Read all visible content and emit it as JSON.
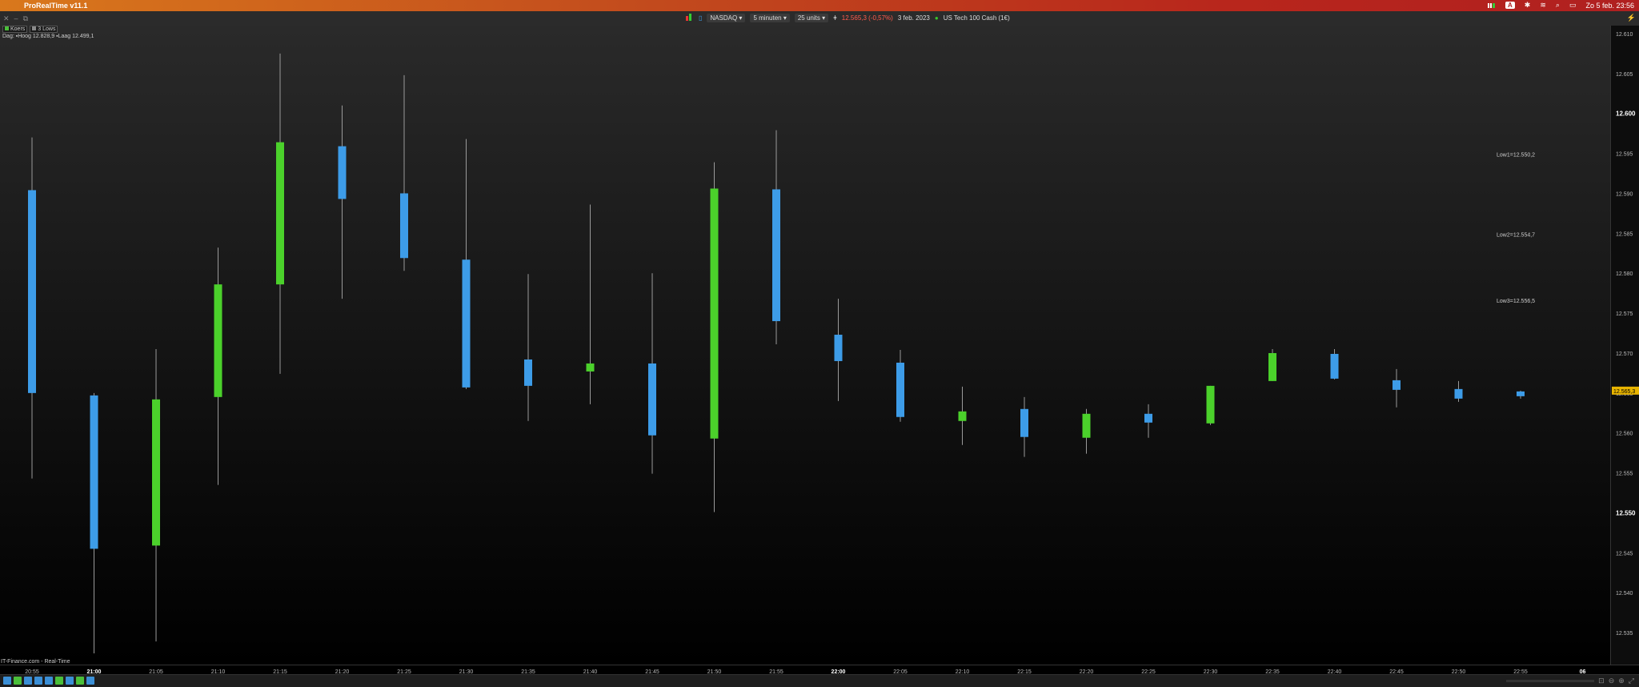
{
  "menubar": {
    "app_name": "ProRealTime v11.1",
    "datetime": "Zo 5 feb. 23:56",
    "input_badge": "A"
  },
  "toolbar": {
    "exchange": "NASDAQ",
    "timeframe": "5 minuten",
    "units": "25 units",
    "price_change": "12.565,3 (-0,57%)",
    "date": "3 feb. 2023",
    "instrument": "US Tech 100 Cash (1€)"
  },
  "legend": {
    "items": [
      "Koers",
      "3 Lows"
    ],
    "colors": [
      "#4bbf3a",
      "#8a8a8a"
    ]
  },
  "info": {
    "text": "Dag: ▪Hoog 12.828,9 ▪Laag 12.499,1"
  },
  "footer": {
    "source": "IT-Finance.com - Real-Time"
  },
  "colors": {
    "up": "#4bd12b",
    "down": "#3d9ce8",
    "wick": "#9a9a9a",
    "current_price_bg": "#e8b400"
  },
  "chart_data": {
    "type": "candlestick",
    "ylim": [
      12531,
      12611
    ],
    "y_ticks": [
      12610,
      12605,
      12600,
      12595,
      12590,
      12585,
      12580,
      12575,
      12570,
      12565,
      12560,
      12555,
      12550,
      12545,
      12540,
      12535
    ],
    "y_tick_labels": [
      "12.610",
      "12.605",
      "12.600",
      "12.595",
      "12.590",
      "12.585",
      "12.580",
      "12.575",
      "12.570",
      "12.565",
      "12.560",
      "12.555",
      "12.550",
      "12.545",
      "12.540",
      "12.535"
    ],
    "bold_ticks": [
      "12.600",
      "12.550"
    ],
    "current_price": 12565.3,
    "current_price_label": "12.565,3",
    "x_labels": [
      "20:55",
      "21:00",
      "21:05",
      "21:10",
      "21:15",
      "21:20",
      "21:25",
      "21:30",
      "21:35",
      "21:40",
      "21:45",
      "21:50",
      "21:55",
      "22:00",
      "22:05",
      "22:10",
      "22:15",
      "22:20",
      "22:25",
      "22:30",
      "22:35",
      "22:40",
      "22:45",
      "22:50",
      "22:55",
      "06"
    ],
    "bold_x_labels": [
      "21:00",
      "22:00",
      "06"
    ],
    "candles": [
      {
        "time": "20:55",
        "open": 12590.4,
        "high": 12597.0,
        "low": 12554.3,
        "close": 12565.0
      },
      {
        "time": "21:00",
        "open": 12564.7,
        "high": 12565.0,
        "low": 12532.4,
        "close": 12545.5
      },
      {
        "time": "21:05",
        "open": 12545.9,
        "high": 12570.5,
        "low": 12533.9,
        "close": 12564.2
      },
      {
        "time": "21:10",
        "open": 12564.5,
        "high": 12583.2,
        "low": 12553.5,
        "close": 12578.6
      },
      {
        "time": "21:15",
        "open": 12578.6,
        "high": 12607.5,
        "low": 12567.4,
        "close": 12596.4
      },
      {
        "time": "21:20",
        "open": 12595.9,
        "high": 12601.0,
        "low": 12576.8,
        "close": 12589.3
      },
      {
        "time": "21:25",
        "open": 12590.0,
        "high": 12604.8,
        "low": 12580.3,
        "close": 12581.9
      },
      {
        "time": "21:30",
        "open": 12581.7,
        "high": 12596.8,
        "low": 12565.5,
        "close": 12565.7
      },
      {
        "time": "21:35",
        "open": 12569.2,
        "high": 12579.9,
        "low": 12561.5,
        "close": 12565.9
      },
      {
        "time": "21:40",
        "open": 12567.7,
        "high": 12588.6,
        "low": 12563.6,
        "close": 12568.7
      },
      {
        "time": "21:45",
        "open": 12568.7,
        "high": 12580.0,
        "low": 12554.9,
        "close": 12559.7
      },
      {
        "time": "21:50",
        "open": 12559.3,
        "high": 12593.9,
        "low": 12550.1,
        "close": 12590.6
      },
      {
        "time": "21:55",
        "open": 12590.5,
        "high": 12597.9,
        "low": 12571.1,
        "close": 12574.0
      },
      {
        "time": "22:00",
        "open": 12572.3,
        "high": 12576.8,
        "low": 12564.0,
        "close": 12569.0
      },
      {
        "time": "22:05",
        "open": 12568.8,
        "high": 12570.4,
        "low": 12561.4,
        "close": 12562.0
      },
      {
        "time": "22:10",
        "open": 12561.5,
        "high": 12565.8,
        "low": 12558.5,
        "close": 12562.7
      },
      {
        "time": "22:15",
        "open": 12563.0,
        "high": 12564.5,
        "low": 12557.0,
        "close": 12559.5
      },
      {
        "time": "22:20",
        "open": 12559.4,
        "high": 12563.0,
        "low": 12557.4,
        "close": 12562.4
      },
      {
        "time": "22:25",
        "open": 12562.4,
        "high": 12563.6,
        "low": 12559.4,
        "close": 12561.3
      },
      {
        "time": "22:30",
        "open": 12561.2,
        "high": 12565.9,
        "low": 12561.0,
        "close": 12565.9
      },
      {
        "time": "22:35",
        "open": 12566.5,
        "high": 12570.5,
        "low": 12566.5,
        "close": 12570.0
      },
      {
        "time": "22:40",
        "open": 12569.9,
        "high": 12570.5,
        "low": 12566.7,
        "close": 12566.8
      },
      {
        "time": "22:45",
        "open": 12566.6,
        "high": 12568.0,
        "low": 12563.2,
        "close": 12565.4
      },
      {
        "time": "22:50",
        "open": 12565.5,
        "high": 12566.5,
        "low": 12563.9,
        "close": 12564.3
      },
      {
        "time": "22:55",
        "open": 12565.2,
        "high": 12565.3,
        "low": 12564.3,
        "close": 12564.6
      }
    ],
    "annotations": [
      {
        "label": "Low1=12.550,2",
        "price": 12594.6
      },
      {
        "label": "Low2=12.554,7",
        "price": 12584.6
      },
      {
        "label": "Low3=12.556,5",
        "price": 12576.3
      }
    ]
  }
}
